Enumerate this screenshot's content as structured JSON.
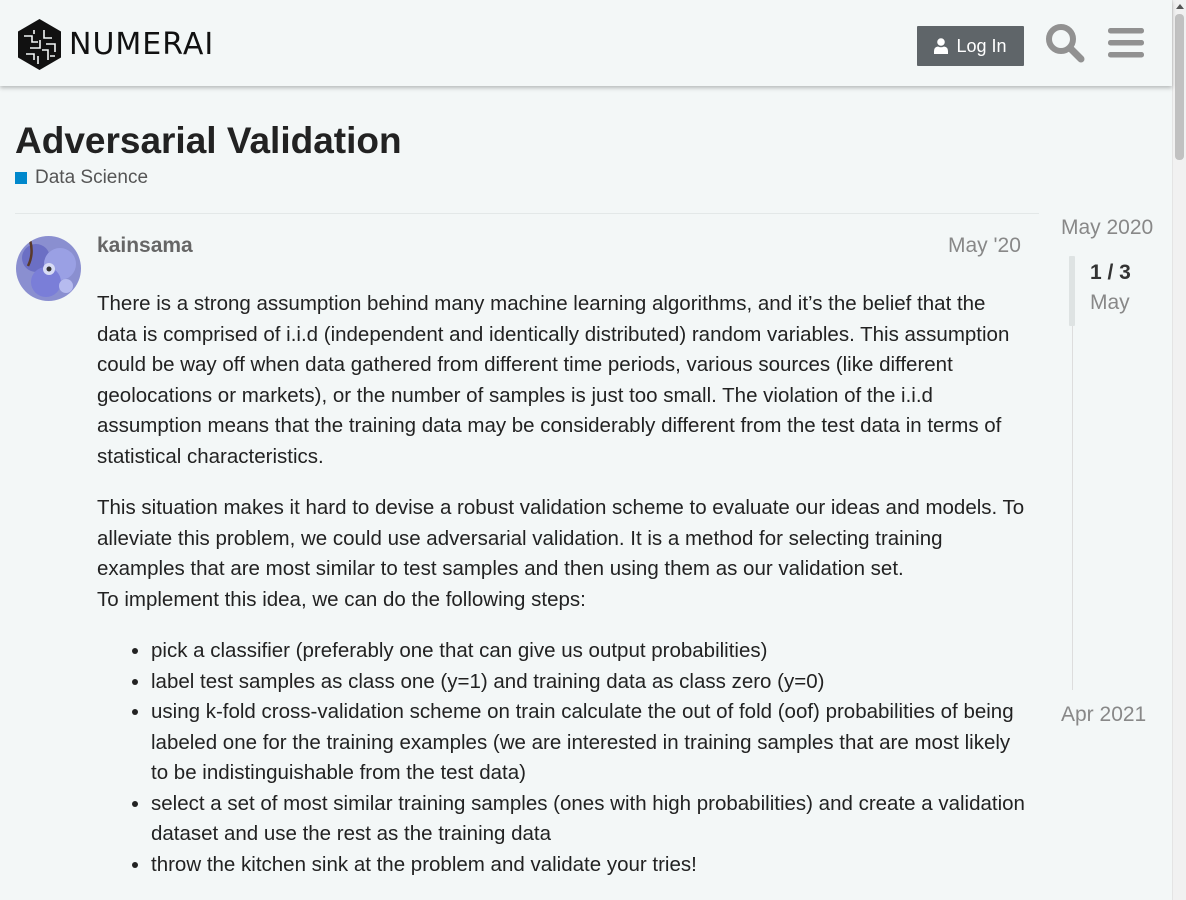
{
  "header": {
    "logo_text": "NUMERAI",
    "login_label": "Log In",
    "icons": {
      "search": "search-icon",
      "menu": "hamburger-menu-icon",
      "login": "user-icon"
    }
  },
  "topic": {
    "title": "Adversarial Validation",
    "category": {
      "label": "Data Science",
      "color": "#0088cc"
    }
  },
  "post": {
    "username": "kainsama",
    "date": "May '20",
    "paragraphs": [
      "There is a strong assumption behind many machine learning algorithms, and it’s the belief that the data is comprised of i.i.d (independent and identically distributed) random variables. This assumption could be way off when data gathered from different time periods, various sources (like different geolocations or markets), or the number of samples is just too small. The violation of the i.i.d assumption means that the training data may be considerably different from the test data in terms of statistical characteristics.",
      "This situation makes it hard to devise a robust validation scheme to evaluate our ideas and models. To alleviate this problem, we could use adversarial validation. It is a method for selecting training examples that are most similar to test samples and then using them as our validation set.",
      "To implement this idea, we can do the following steps:"
    ],
    "steps": [
      "pick a classifier (preferably one that can give us output probabilities)",
      "label test samples as class one (y=1) and training data as class zero (y=0)",
      "using k-fold cross-validation scheme on train calculate the out of fold (oof) probabilities of being labeled one for the training examples (we are interested in training samples that are most likely to be indistinguishable from the test data)",
      "select a set of most similar training samples (ones with high probabilities) and create a validation dataset and use the rest as the training data",
      "throw the kitchen sink at the problem and validate your tries!"
    ]
  },
  "timeline": {
    "start": "May 2020",
    "position": "1 / 3",
    "current": "May",
    "end": "Apr 2021"
  },
  "colors": {
    "accent": "#0088cc",
    "button": "#5f6569",
    "background": "#f3f7f7"
  }
}
